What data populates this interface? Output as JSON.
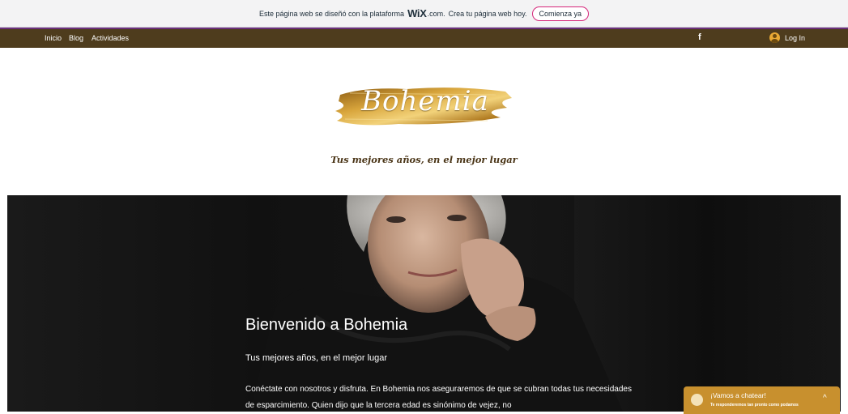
{
  "wix_banner": {
    "text": "Este página web se diseñó con la plataforma",
    "brand": "WiX",
    "brand_suffix": ".com.",
    "text2": "Crea tu página web hoy.",
    "cta": "Comienza ya"
  },
  "nav": {
    "items": [
      {
        "label": "Inicio"
      },
      {
        "label": "Blog"
      },
      {
        "label": "Actividades"
      }
    ],
    "facebook_icon": "f",
    "login_label": "Log In"
  },
  "logo": {
    "text": "Bohemia",
    "tagline": "Tus mejores años, en el mejor lugar"
  },
  "hero": {
    "title": "Bienvenido a Bohemia",
    "subtitle": "Tus mejores años, en el mejor lugar",
    "body": "Conéctate con nosotros y disfruta.  En Bohemia nos aseguraremos de que se cubran todas tus necesidades de esparcimiento.  Quien dijo que la tercera edad es sinónimo de vejez, no"
  },
  "chat": {
    "title": "¡Vamos a chatear!",
    "subtitle": "Te responderemos tan pronto como podamos",
    "chevron": "^"
  },
  "colors": {
    "nav_bg": "#4e3c1d",
    "accent_gold": "#c8902e",
    "wix_pink": "#d6267a"
  }
}
